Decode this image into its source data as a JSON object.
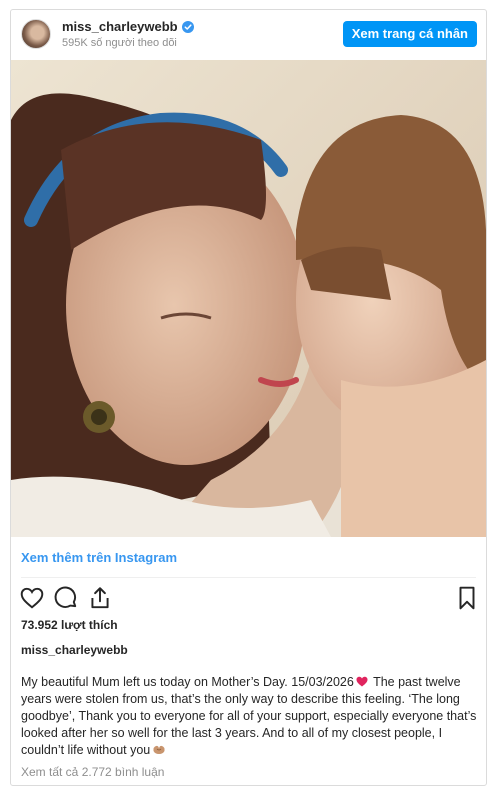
{
  "header": {
    "username": "miss_charleywebb",
    "followers": "595K số người theo dõi",
    "view_profile_label": "Xem trang cá nhân"
  },
  "post": {
    "more_on_instagram": "Xem thêm trên Instagram",
    "likes": "73.952 lượt thích",
    "author": "miss_charleywebb",
    "caption_part1": "My beautiful Mum left us today on Mother’s Day. 15/03/2026",
    "caption_part2": "The past twelve years were stolen from us, that’s the only way to describe this feeling. ‘The long goodbye’, Thank you to everyone for all of your support, especially everyone that’s looked after her so well for the last 3 years. And to all of my closest people, I couldn’t life without you",
    "view_comments": "Xem tất cả 2.772 bình luận"
  },
  "icons": {
    "verified": "verified-badge-icon",
    "like": "heart-outline-icon",
    "comment": "speech-bubble-icon",
    "share": "share-icon",
    "save": "bookmark-icon"
  },
  "colors": {
    "accent": "#0095f6",
    "link": "#3897f0",
    "muted": "#8e8e8e",
    "emoji_heart": "#e0245e"
  }
}
